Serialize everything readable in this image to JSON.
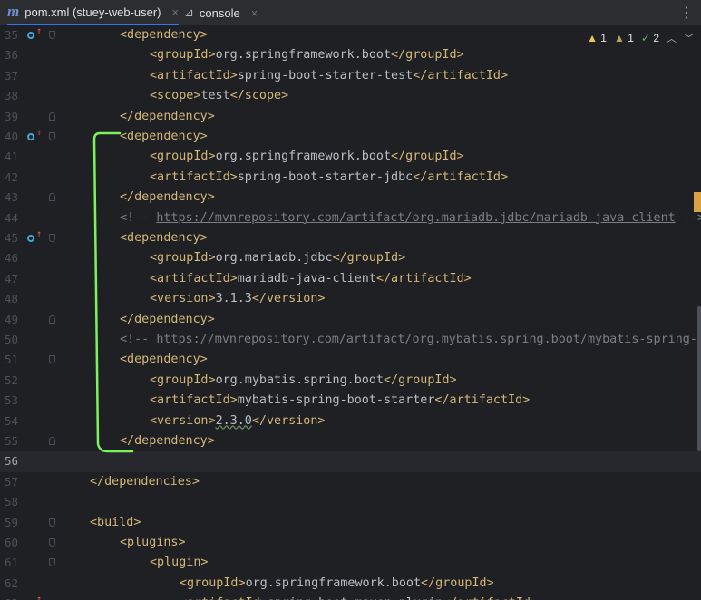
{
  "tabs": [
    {
      "label": "pom.xml (stuey-web-user)",
      "icon": "maven-icon",
      "active": true
    },
    {
      "label": "console",
      "icon": "console-icon",
      "active": false
    }
  ],
  "inspection": {
    "warnings": "1",
    "weak_warnings": "1",
    "typos": "2"
  },
  "lines": [
    {
      "n": "35",
      "indent": 1,
      "parts": [
        [
          "tag",
          "<dependency>"
        ]
      ],
      "marker": true,
      "fold": "open"
    },
    {
      "n": "36",
      "indent": 2,
      "parts": [
        [
          "tag",
          "<groupId>"
        ],
        [
          "txt",
          "org.springframework.boot"
        ],
        [
          "tag",
          "</groupId>"
        ]
      ]
    },
    {
      "n": "37",
      "indent": 2,
      "parts": [
        [
          "tag",
          "<artifactId>"
        ],
        [
          "txt",
          "spring-boot-starter-test"
        ],
        [
          "tag",
          "</artifactId>"
        ]
      ]
    },
    {
      "n": "38",
      "indent": 2,
      "parts": [
        [
          "tag",
          "<scope>"
        ],
        [
          "txt",
          "test"
        ],
        [
          "tag",
          "</scope>"
        ]
      ]
    },
    {
      "n": "39",
      "indent": 1,
      "parts": [
        [
          "tag",
          "</dependency>"
        ]
      ],
      "fold": "close"
    },
    {
      "n": "40",
      "indent": 1,
      "parts": [
        [
          "tag",
          "<dependency>"
        ]
      ],
      "marker": true,
      "fold": "open"
    },
    {
      "n": "41",
      "indent": 2,
      "parts": [
        [
          "tag",
          "<groupId>"
        ],
        [
          "txt",
          "org.springframework.boot"
        ],
        [
          "tag",
          "</groupId>"
        ]
      ]
    },
    {
      "n": "42",
      "indent": 2,
      "parts": [
        [
          "tag",
          "<artifactId>"
        ],
        [
          "txt",
          "spring-boot-starter-jdbc"
        ],
        [
          "tag",
          "</artifactId>"
        ]
      ]
    },
    {
      "n": "43",
      "indent": 1,
      "parts": [
        [
          "tag",
          "</dependency>"
        ]
      ],
      "fold": "close"
    },
    {
      "n": "44",
      "indent": 1,
      "parts": [
        [
          "cmt",
          "<!-- "
        ],
        [
          "url",
          "https://mvnrepository.com/artifact/org.mariadb.jdbc/mariadb-java-client"
        ],
        [
          "cmt",
          " -->"
        ]
      ]
    },
    {
      "n": "45",
      "indent": 1,
      "parts": [
        [
          "tag",
          "<dependency>"
        ]
      ],
      "marker": true,
      "fold": "open"
    },
    {
      "n": "46",
      "indent": 2,
      "parts": [
        [
          "tag",
          "<groupId>"
        ],
        [
          "txt",
          "org.mariadb.jdbc"
        ],
        [
          "tag",
          "</groupId>"
        ]
      ]
    },
    {
      "n": "47",
      "indent": 2,
      "parts": [
        [
          "tag",
          "<artifactId>"
        ],
        [
          "txt",
          "mariadb-java-client"
        ],
        [
          "tag",
          "</artifactId>"
        ]
      ]
    },
    {
      "n": "48",
      "indent": 2,
      "parts": [
        [
          "tag",
          "<version>"
        ],
        [
          "txt",
          "3.1.3"
        ],
        [
          "tag",
          "</version>"
        ]
      ]
    },
    {
      "n": "49",
      "indent": 1,
      "parts": [
        [
          "tag",
          "</dependency>"
        ]
      ],
      "fold": "close"
    },
    {
      "n": "50",
      "indent": 1,
      "parts": [
        [
          "cmt",
          "<!-- "
        ],
        [
          "url",
          "https://mvnrepository.com/artifact/org.mybatis.spring.boot/mybatis-spring-boot-starter"
        ],
        [
          "cmt",
          " -->"
        ]
      ]
    },
    {
      "n": "51",
      "indent": 1,
      "parts": [
        [
          "tag",
          "<dependency>"
        ]
      ],
      "fold": "open"
    },
    {
      "n": "52",
      "indent": 2,
      "parts": [
        [
          "tag",
          "<groupId>"
        ],
        [
          "txt",
          "org.mybatis.spring.boot"
        ],
        [
          "tag",
          "</groupId>"
        ]
      ]
    },
    {
      "n": "53",
      "indent": 2,
      "parts": [
        [
          "tag",
          "<artifactId>"
        ],
        [
          "txt",
          "mybatis-spring-boot-starter"
        ],
        [
          "tag",
          "</artifactId>"
        ]
      ]
    },
    {
      "n": "54",
      "indent": 2,
      "parts": [
        [
          "tag",
          "<version>"
        ],
        [
          "wavy",
          "2.3.0"
        ],
        [
          "tag",
          "</version>"
        ]
      ]
    },
    {
      "n": "55",
      "indent": 1,
      "parts": [
        [
          "tag",
          "</dependency>"
        ]
      ],
      "fold": "close"
    },
    {
      "n": "56",
      "indent": 0,
      "parts": [],
      "current": true
    },
    {
      "n": "57",
      "indent": 0,
      "parts": [
        [
          "tag",
          "</dependencies>"
        ]
      ]
    },
    {
      "n": "58",
      "indent": 0,
      "parts": []
    },
    {
      "n": "59",
      "indent": 0,
      "parts": [
        [
          "tag",
          "<build>"
        ]
      ],
      "fold": "open"
    },
    {
      "n": "60",
      "indent": 1,
      "parts": [
        [
          "tag",
          "<plugins>"
        ]
      ],
      "fold": "open"
    },
    {
      "n": "61",
      "indent": 2,
      "parts": [
        [
          "tag",
          "<plugin>"
        ]
      ],
      "fold": "open"
    },
    {
      "n": "62",
      "indent": 3,
      "parts": [
        [
          "tag",
          "<groupId>"
        ],
        [
          "txt",
          "org.springframework.boot"
        ],
        [
          "tag",
          "</groupId>"
        ]
      ]
    },
    {
      "n": "63",
      "indent": 3,
      "parts": [
        [
          "tag",
          "<artifactId>"
        ],
        [
          "txt",
          "spring-boot-maven-plugin"
        ],
        [
          "tag",
          "</artifactId>"
        ]
      ],
      "marker": true
    }
  ]
}
